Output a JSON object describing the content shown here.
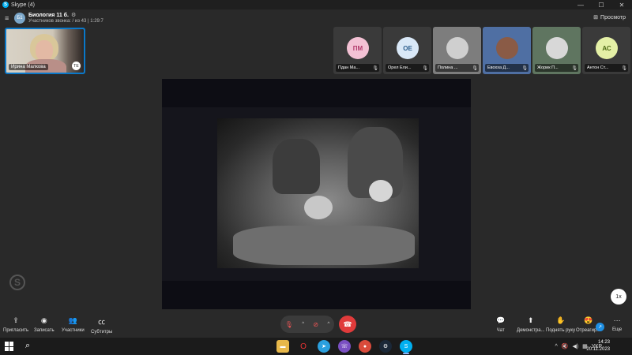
{
  "titlebar": {
    "app_title": "Skype (4)",
    "minimize": "—",
    "maximize": "☐",
    "close": "✕"
  },
  "call": {
    "group_initials": "Б1",
    "group_title": "Биология 11 б.",
    "subtitle": "Участников звонка: / из 43 | 1:29:7",
    "view_label": "Просмотр"
  },
  "self_tile": {
    "name": "Ирина Малкова",
    "badge": "ТЕ"
  },
  "participants": [
    {
      "initials": "ПМ",
      "name": "Пдан Ма...",
      "avatar_color": "#f3c1d4"
    },
    {
      "initials": "ОЕ",
      "name": "Орел Ели...",
      "avatar_color": "#d9e8f7"
    },
    {
      "initials": "",
      "name": "Полина ...",
      "avatar_color": "#9c9c9c"
    },
    {
      "initials": "",
      "name": "Евохха Д...",
      "avatar_color": "#6b8fc0"
    },
    {
      "initials": "",
      "name": "Жорик П...",
      "avatar_color": "#9fb09a"
    },
    {
      "initials": "АС",
      "name": "Антон Ст...",
      "avatar_color": "#e4f0a6"
    }
  ],
  "zoom_label": "1x",
  "controls": {
    "invite": "Пригласить",
    "record": "Записать",
    "participants": "Участники",
    "subtitles": "Субтитры",
    "chat": "Чат",
    "share": "Демонстра...",
    "raise_hand": "Поднять руку",
    "react": "Отреагир...",
    "more": "Еще"
  },
  "taskbar": {
    "language": "УКР",
    "time": "14:23",
    "date": "20.11.2023"
  },
  "colors": {
    "accent": "#0a78c9",
    "hangup": "#e03b3b",
    "background": "#292929"
  }
}
